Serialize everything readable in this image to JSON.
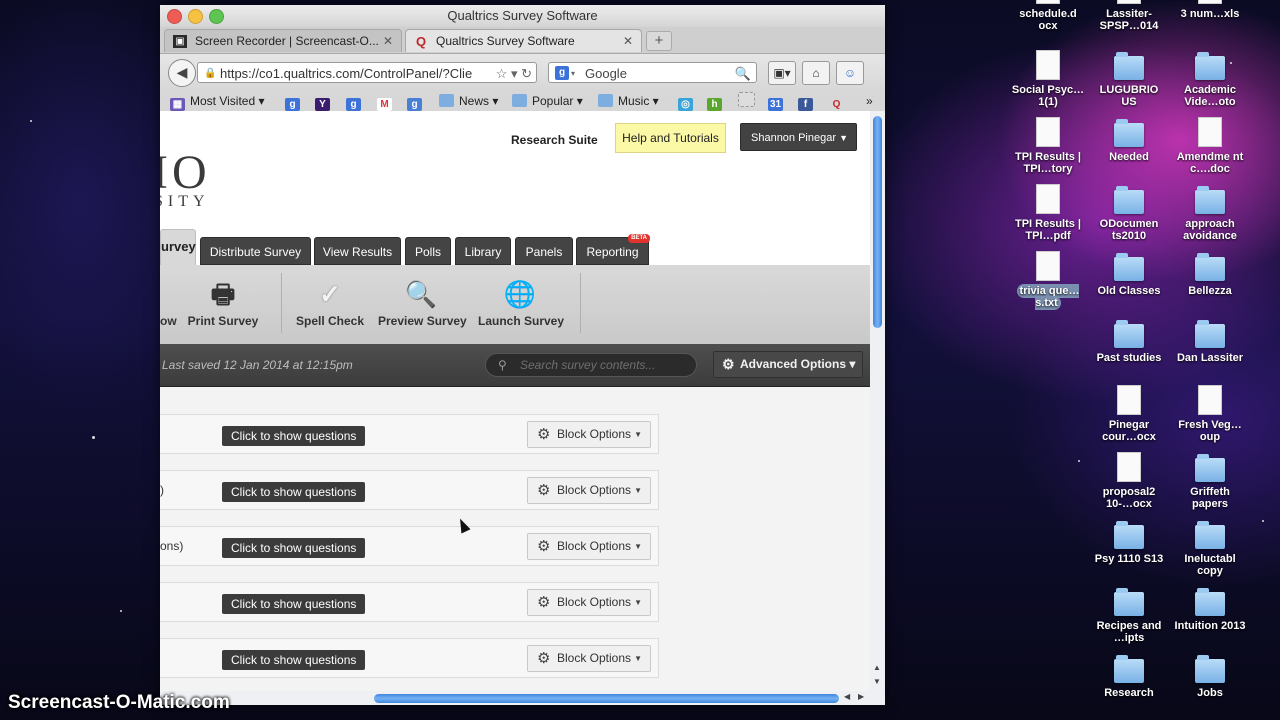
{
  "browser": {
    "window_title": "Qualtrics Survey Software",
    "tabs": [
      {
        "label": "Screen Recorder | Screencast-O...",
        "icon": "screencast-favicon",
        "active": false
      },
      {
        "label": "Qualtrics Survey Software",
        "icon": "qualtrics-favicon",
        "active": true
      }
    ],
    "url": "https://co1.qualtrics.com/ControlPanel/?Clie",
    "search_placeholder": "Google",
    "bookmarks": [
      {
        "label": "Most Visited",
        "icon": "most-visited-icon",
        "dropdown": true
      },
      {
        "label": "News",
        "icon": "folder-icon",
        "dropdown": true
      },
      {
        "label": "Popular",
        "icon": "folder-icon",
        "dropdown": true
      },
      {
        "label": "Music",
        "icon": "folder-icon",
        "dropdown": true
      }
    ]
  },
  "header": {
    "logo_big": "IO",
    "logo_small": "SITY",
    "research_suite": "Research Suite",
    "help": "Help and Tutorials",
    "user": "Shannon Pinegar"
  },
  "nav_tabs": [
    {
      "label": "urvey",
      "active": true
    },
    {
      "label": "Distribute Survey"
    },
    {
      "label": "View Results"
    },
    {
      "label": "Polls"
    },
    {
      "label": "Library"
    },
    {
      "label": "Panels"
    },
    {
      "label": "Reporting",
      "badge": "BETA"
    }
  ],
  "toolbar": {
    "items": [
      {
        "label": "ow",
        "icon": ""
      },
      {
        "label": "Print Survey",
        "icon": "printer-icon"
      },
      {
        "label": "Spell Check",
        "icon": "checkmark-icon"
      },
      {
        "label": "Preview Survey",
        "icon": "magnifier-icon"
      },
      {
        "label": "Launch Survey",
        "icon": "globe-icon"
      }
    ]
  },
  "savebar": {
    "saved": "Last saved 12 Jan 2014 at 12:15pm",
    "search_placeholder": "Search survey contents...",
    "advanced": "Advanced Options"
  },
  "blocks": [
    {
      "label": "",
      "show": "Click to show questions",
      "options": "Block Options"
    },
    {
      "label": ")",
      "show": "Click to show questions",
      "options": "Block Options"
    },
    {
      "label": "ons)",
      "show": "Click to show questions",
      "options": "Block Options"
    },
    {
      "label": "",
      "show": "Click to show questions",
      "options": "Block Options"
    },
    {
      "label": "",
      "show": "Click to show questions",
      "options": "Block Options"
    }
  ],
  "desktop": {
    "icons": [
      {
        "label": "schedule.d ocx",
        "type": "doc"
      },
      {
        "label": "Lassiter-SPSP…014",
        "type": "doc"
      },
      {
        "label": "3 num…xls",
        "type": "doc"
      },
      {
        "label": "Social Psyc…1(1)",
        "type": "doc"
      },
      {
        "label": "LUGUBRIO US",
        "type": "folder"
      },
      {
        "label": "Academic Vide…oto",
        "type": "folder"
      },
      {
        "label": "TPI Results | TPI…tory",
        "type": "doc"
      },
      {
        "label": "Needed",
        "type": "folder"
      },
      {
        "label": "Amendme nt c….doc",
        "type": "doc"
      },
      {
        "label": "TPI Results | TPI…pdf",
        "type": "doc"
      },
      {
        "label": "ODocumen ts2010",
        "type": "folder"
      },
      {
        "label": "approach avoidance",
        "type": "folder"
      },
      {
        "label": "trivia que…s.txt",
        "type": "doc"
      },
      {
        "label": "Old Classes",
        "type": "folder"
      },
      {
        "label": "Bellezza",
        "type": "folder"
      },
      {
        "label": "Past studies",
        "type": "folder"
      },
      {
        "label": "Dan Lassiter",
        "type": "folder"
      },
      {
        "label": "Pinegar cour…ocx",
        "type": "doc"
      },
      {
        "label": "Fresh Veg…oup",
        "type": "doc"
      },
      {
        "label": "proposal2 10-…ocx",
        "type": "doc"
      },
      {
        "label": "Griffeth papers",
        "type": "folder"
      },
      {
        "label": "Psy 1110 S13",
        "type": "folder"
      },
      {
        "label": "Ineluctabl copy",
        "type": "folder"
      },
      {
        "label": "Recipes and …ipts",
        "type": "folder"
      },
      {
        "label": "Intuition 2013",
        "type": "folder"
      },
      {
        "label": "Research",
        "type": "folder"
      },
      {
        "label": "Jobs",
        "type": "folder"
      }
    ]
  },
  "watermark": "Screencast-O-Matic.com"
}
